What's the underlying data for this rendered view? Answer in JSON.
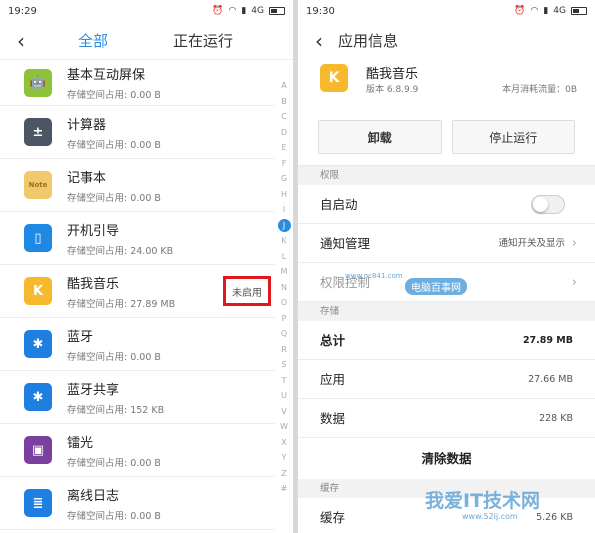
{
  "left": {
    "status": {
      "time": "19:29",
      "net": "4G"
    },
    "header": {
      "back": "‹",
      "tab_all": "全部",
      "tab_running": "正在运行"
    },
    "apps": [
      {
        "name": "基本互动屏保",
        "size": "存储空间占用: 0.00 B",
        "icon": "android-icon",
        "color": "#8fc23b",
        "glyph": "🤖"
      },
      {
        "name": "计算器",
        "size": "存储空间占用: 0.00 B",
        "icon": "calculator-icon",
        "color": "#4b5563",
        "glyph": "±"
      },
      {
        "name": "记事本",
        "size": "存储空间占用: 0.00 B",
        "icon": "notepad-icon",
        "color": "#f0c96a",
        "glyph": "Note"
      },
      {
        "name": "开机引导",
        "size": "存储空间占用: 24.00 KB",
        "icon": "phone-icon",
        "color": "#1e88e5",
        "glyph": "▯"
      },
      {
        "name": "酷我音乐",
        "size": "存储空间占用: 27.89 MB",
        "icon": "kuwo-music-icon",
        "color": "#f6b82c",
        "glyph": "K",
        "tag": "未启用"
      },
      {
        "name": "蓝牙",
        "size": "存储空间占用: 0.00 B",
        "icon": "bluetooth-icon",
        "color": "#1e7fe0",
        "glyph": "✱"
      },
      {
        "name": "蓝牙共享",
        "size": "存储空间占用: 152 KB",
        "icon": "bluetooth-share-icon",
        "color": "#1e7fe0",
        "glyph": "✱"
      },
      {
        "name": "镭光",
        "size": "存储空间占用: 0.00 B",
        "icon": "laser-icon",
        "color": "#7b3fa0",
        "glyph": "▣"
      },
      {
        "name": "离线日志",
        "size": "存储空间占用: 0.00 B",
        "icon": "log-icon",
        "color": "#1e7fe0",
        "glyph": "≣"
      }
    ],
    "index": [
      "A",
      "B",
      "C",
      "D",
      "E",
      "F",
      "G",
      "H",
      "I",
      "J",
      "K",
      "L",
      "M",
      "N",
      "O",
      "P",
      "Q",
      "R",
      "S",
      "T",
      "U",
      "V",
      "W",
      "X",
      "Y",
      "Z",
      "#"
    ],
    "index_active": "J"
  },
  "right": {
    "status": {
      "time": "19:30",
      "net": "4G"
    },
    "header": {
      "back": "‹",
      "title": "应用信息"
    },
    "app": {
      "name": "酷我音乐",
      "version": "版本 6.8.9.9",
      "traffic": "本月消耗流量：0B"
    },
    "buttons": {
      "uninstall": "卸载",
      "stop": "停止运行"
    },
    "permissions": {
      "section": "权限",
      "autostart": "自启动",
      "notify": "通知管理",
      "notify_value": "通知开关及显示",
      "perm_control": "权限控制"
    },
    "storage": {
      "section": "存储",
      "total_label": "总计",
      "total": "27.89 MB",
      "app_label": "应用",
      "app": "27.66 MB",
      "data_label": "数据",
      "data": "228 KB",
      "clear": "清除数据"
    },
    "cache": {
      "section": "缓存",
      "label": "缓存",
      "value": "5.26 KB"
    }
  },
  "watermarks": {
    "site1": "www.pc841.com",
    "site1_name": "电脑百事网",
    "site2_name": "我爱IT技术网",
    "site2": "www.52ij.com"
  }
}
